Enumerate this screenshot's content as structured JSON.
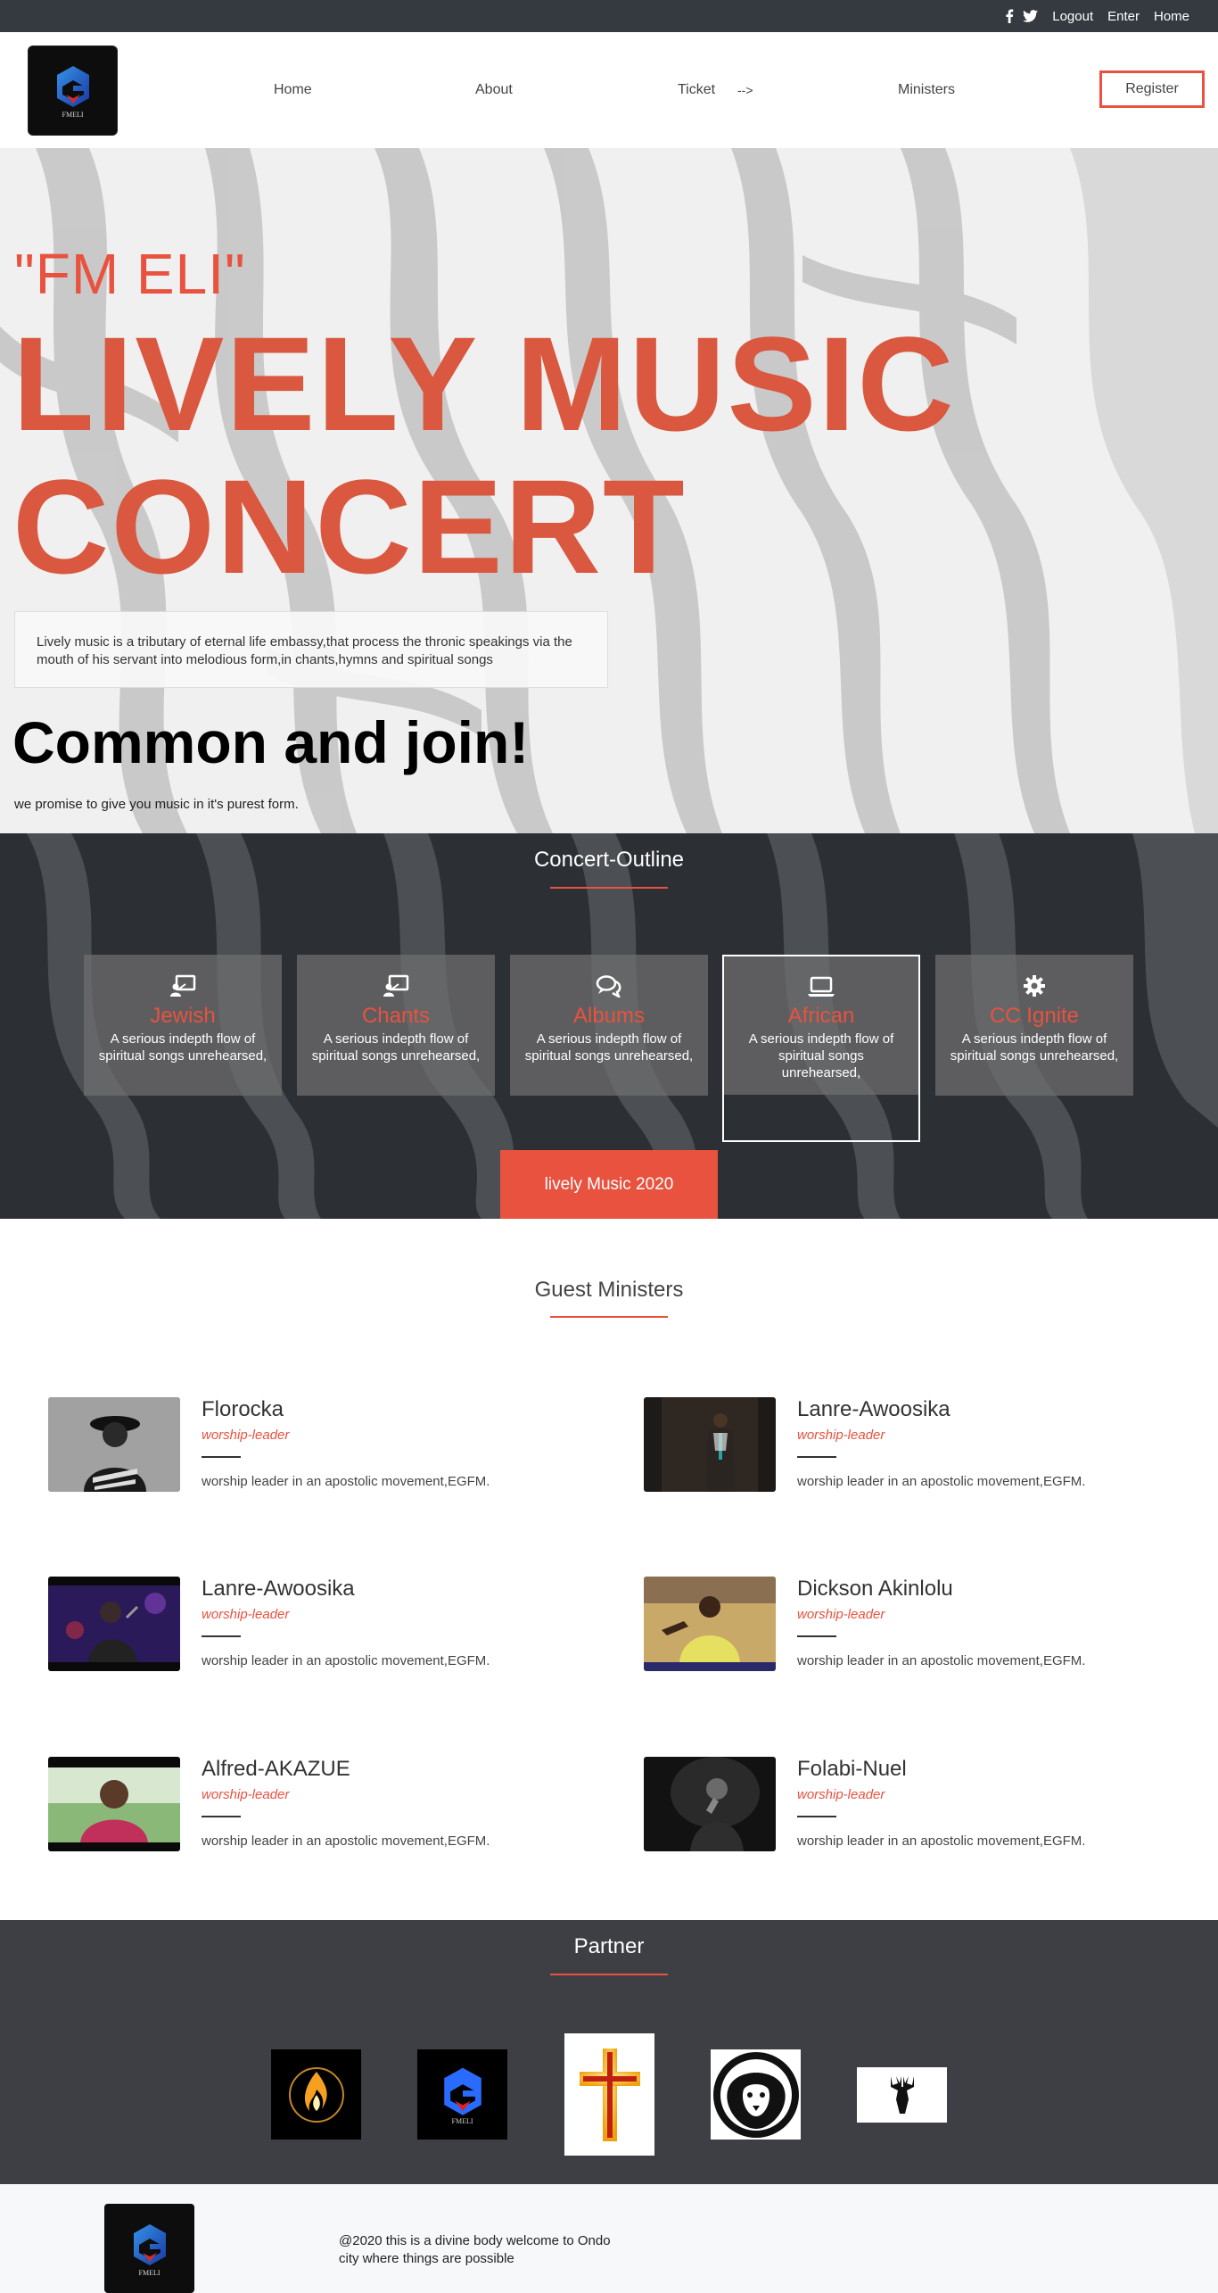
{
  "topbar": {
    "icons": [
      "facebook-icon",
      "twitter-icon"
    ],
    "links": [
      "Logout",
      "Enter",
      "Home"
    ]
  },
  "header": {
    "logo_text": "FMELI",
    "nav": {
      "home": "Home",
      "about": "About",
      "ticket": "Ticket",
      "arrow": "-->",
      "ministers": "Ministers"
    },
    "register": "Register"
  },
  "hero": {
    "subtitle": "\"FM ELI\"",
    "title_line1": "LIVELY MUSIC",
    "title_line2": "CONCERT",
    "description": "Lively music is a tributary of eternal life embassy,that process the thronic speakings via the mouth of his servant into melodious form,in chants,hymns and spiritual songs",
    "join": "Common and join!",
    "promise": "we promise to give you music in it's purest form."
  },
  "outline": {
    "title": "Concert-Outline",
    "cards": [
      {
        "icon": "presentation-icon",
        "title": "Jewish",
        "text": "A serious indepth flow of spiritual songs unrehearsed,"
      },
      {
        "icon": "presentation-icon",
        "title": "Chants",
        "text": "A serious indepth flow of spiritual songs unrehearsed,"
      },
      {
        "icon": "chat-bubbles-icon",
        "title": "Albums",
        "text": "A serious indepth flow of spiritual songs unrehearsed,"
      },
      {
        "icon": "laptop-icon",
        "title": "African",
        "text": "A serious indepth flow of spiritual songs unrehearsed,"
      },
      {
        "icon": "gear-icon",
        "title": "CC Ignite",
        "text": "A serious indepth flow of spiritual songs unrehearsed,"
      }
    ],
    "button": "lively Music 2020"
  },
  "ministers": {
    "title": "Guest Ministers",
    "items": [
      {
        "name": "Florocka",
        "role": "worship-leader",
        "bio": "worship leader in an apostolic movement,EGFM."
      },
      {
        "name": "Lanre-Awoosika",
        "role": "worship-leader",
        "bio": "worship leader in an apostolic movement,EGFM."
      },
      {
        "name": "Lanre-Awoosika",
        "role": "worship-leader",
        "bio": "worship leader in an apostolic movement,EGFM."
      },
      {
        "name": "Dickson Akinlolu",
        "role": "worship-leader",
        "bio": "worship leader in an apostolic movement,EGFM."
      },
      {
        "name": "Alfred-AKAZUE",
        "role": "worship-leader",
        "bio": "worship leader in an apostolic movement,EGFM."
      },
      {
        "name": "Folabi-Nuel",
        "role": "worship-leader",
        "bio": "worship leader in an apostolic movement,EGFM."
      }
    ]
  },
  "partner": {
    "title": "Partner",
    "logos": [
      "flame-logo-icon",
      "fmeli-logo-icon",
      "cross-logo-icon",
      "lion-logo-icon",
      "deer-logo-icon"
    ]
  },
  "footer": {
    "logo_text": "FMELI",
    "text": "@2020 this is a divine body welcome to Ondo city where things are possible"
  },
  "colors": {
    "accent": "#e8523f",
    "dark": "#343a40",
    "section_dark": "#3d3f44"
  }
}
